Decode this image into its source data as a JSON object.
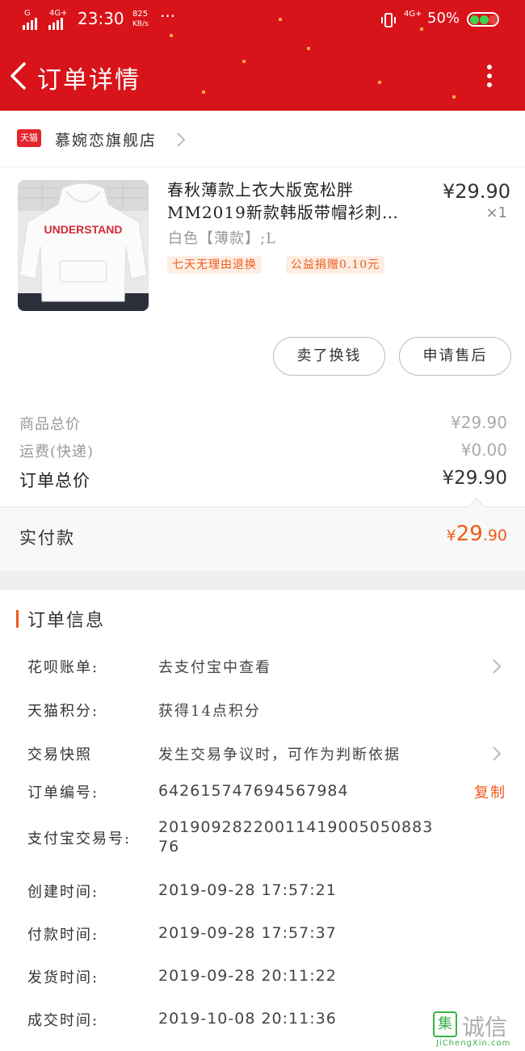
{
  "status_bar": {
    "net1": "G",
    "net2": "4G+",
    "time": "23:30",
    "speed_value": "825",
    "speed_unit": "KB/s",
    "more": "···",
    "net3": "4G+",
    "battery": "50%"
  },
  "header": {
    "title": "订单详情"
  },
  "store": {
    "badge": "天猫",
    "name": "慕婉恋旗舰店"
  },
  "product": {
    "title_line1": "春秋薄款上衣大版宽松胖",
    "title_line2": "MM2019新款韩版带帽衫刺…",
    "price": "¥29.90",
    "quantity": "×1",
    "spec": "白色【薄款】;L",
    "tags": [
      "七天无理由退换",
      "公益捐赠0.10元"
    ],
    "image_text": "UNDERSTAND"
  },
  "actions": {
    "sell_back": "卖了换钱",
    "after_sale": "申请售后"
  },
  "summary": {
    "goods_total_label": "商品总价",
    "goods_total_value": "¥29.90",
    "shipping_label": "运费(快递)",
    "shipping_value": "¥0.00",
    "order_total_label": "订单总价",
    "order_total_value": "¥29.90"
  },
  "paid": {
    "label": "实付款",
    "currency": "¥",
    "amount_int": "29",
    "amount_dec": ".90"
  },
  "order_info": {
    "title": "订单信息",
    "huabei_label": "花呗账单:",
    "huabei_value": "去支付宝中查看",
    "points_label": "天猫积分:",
    "points_value": "获得14点积分",
    "snapshot_label": "交易快照",
    "snapshot_value": "发生交易争议时，可作为判断依据",
    "order_no_label": "订单编号:",
    "order_no_value": "642615747694567984",
    "copy": "复制",
    "alipay_no_label": "支付宝交易号:",
    "alipay_no_line1": "2019092822001141900505088​3",
    "alipay_no_line2": "76",
    "created_label": "创建时间:",
    "created_value": "2019-09-28 17:57:21",
    "paid_label": "付款时间:",
    "paid_value": "2019-09-28 17:57:37",
    "shipped_label": "发货时间:",
    "shipped_value": "2019-09-28 20:11:22",
    "completed_label": "成交时间:",
    "completed_value": "2019-10-08 20:11:36"
  },
  "watermark": {
    "mark": "集",
    "text": "诚信",
    "url": "JiChengXin.com"
  },
  "colors": {
    "header_red": "#d9131a",
    "accent_orange": "#f05a1a",
    "tag_bg": "#fdeee4"
  }
}
